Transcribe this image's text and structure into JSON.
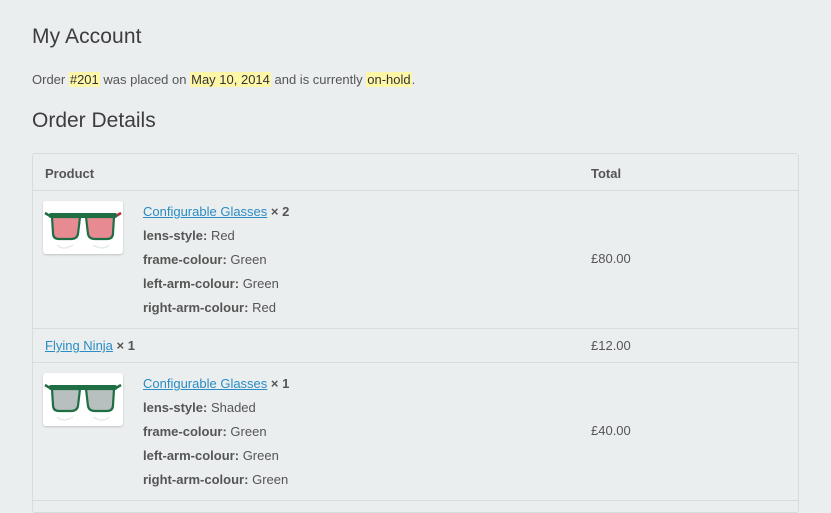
{
  "page": {
    "title": "My Account",
    "status": {
      "prefix": "Order ",
      "order_number": "#201",
      "mid": " was placed on ",
      "date": "May 10, 2014",
      "mid2": " and is currently ",
      "state": "on-hold",
      "suffix": "."
    },
    "section_title": "Order Details"
  },
  "table": {
    "headers": {
      "product": "Product",
      "total": "Total"
    },
    "rows": [
      {
        "name": "Configurable Glasses",
        "qty": "× 2",
        "meta": [
          {
            "key": "lens-style:",
            "value": "Red"
          },
          {
            "key": "frame-colour:",
            "value": "Green"
          },
          {
            "key": "left-arm-colour:",
            "value": "Green"
          },
          {
            "key": "right-arm-colour:",
            "value": "Red"
          }
        ],
        "total": "£80.00",
        "thumb_colors": {
          "frame": "#1f6e44",
          "lens": "#e88a92",
          "arm": "#b0303a"
        }
      },
      {
        "name": "Flying Ninja",
        "qty": "× 1",
        "meta": [],
        "total": "£12.00"
      },
      {
        "name": "Configurable Glasses",
        "qty": "× 1",
        "meta": [
          {
            "key": "lens-style:",
            "value": "Shaded"
          },
          {
            "key": "frame-colour:",
            "value": "Green"
          },
          {
            "key": "left-arm-colour:",
            "value": "Green"
          },
          {
            "key": "right-arm-colour:",
            "value": "Green"
          }
        ],
        "total": "£40.00",
        "thumb_colors": {
          "frame": "#1f6e44",
          "lens": "#b8bfbf",
          "arm": "#1f6e44"
        }
      }
    ]
  },
  "colors": {
    "link": "#2a8cc2",
    "highlight": "#fff7a8",
    "background": "#ebeeef"
  }
}
